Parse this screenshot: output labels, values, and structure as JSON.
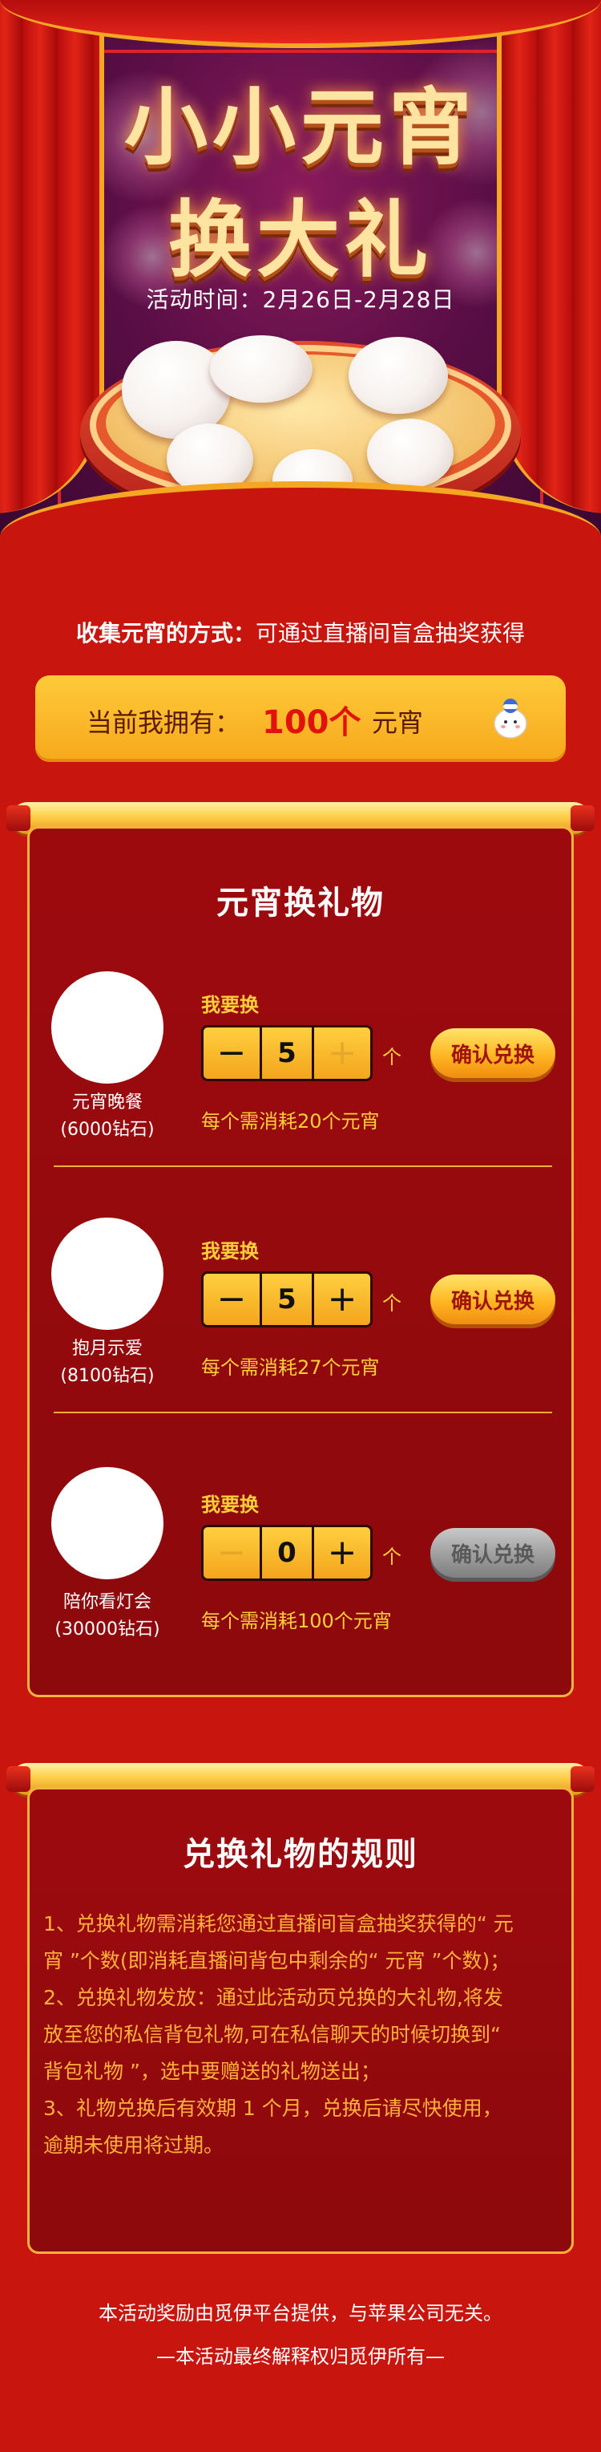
{
  "hero": {
    "title_line1": "小小元宵",
    "title_line2": "换大礼",
    "date": "活动时间：2月26日-2月28日"
  },
  "collect": {
    "label": "收集元宵的方式：",
    "text": "可通过直播间盲盒抽奖获得"
  },
  "own": {
    "label": "当前我拥有：",
    "count": "100个",
    "unit": "元宵",
    "mascot_icon": "tangyuan-mascot-icon"
  },
  "exchange": {
    "title": "元宵换礼物",
    "want_label": "我要换",
    "unit": "个",
    "confirm_label": "确认兑换",
    "gifts": [
      {
        "name": "元宵晚餐",
        "price": "(6000钻石)",
        "qty": "5",
        "cost": "每个需消耗20个元宵",
        "minus_enabled": true,
        "plus_enabled": false,
        "confirm_enabled": true
      },
      {
        "name": "抱月示爱",
        "price": "(8100钻石)",
        "qty": "5",
        "cost": "每个需消耗27个元宵",
        "minus_enabled": true,
        "plus_enabled": true,
        "confirm_enabled": true
      },
      {
        "name": "陪你看灯会",
        "price": "(30000钻石)",
        "qty": "0",
        "cost": "每个需消耗100个元宵",
        "minus_enabled": false,
        "plus_enabled": true,
        "confirm_enabled": false
      }
    ]
  },
  "rules": {
    "title": "兑换礼物的规则",
    "items": [
      "1、兑换礼物需消耗您通过直播间盲盒抽奖获得的“ 元宵 ”个数(即消耗直播间背包中剩余的“ 元宵 ”个数)；",
      "2、兑换礼物发放：通过此活动页兑换的大礼物,将发放至您的私信背包礼物,可在私信聊天的时候切换到“ 背包礼物 ”，选中要赠送的礼物送出；",
      "3、礼物兑换后有效期 1 个月，兑换后请尽快使用，逾期未使用将过期。"
    ]
  },
  "footer": {
    "line1": "本活动奖励由觅伊平台提供，与苹果公司无关。",
    "line2": "—本活动最终解释权归觅伊所有—"
  },
  "colors": {
    "page_bg": "#c8150e",
    "panel_bg": "#9d0a0e",
    "gold": "#ffcf3a",
    "accent_red": "#e0120b"
  }
}
